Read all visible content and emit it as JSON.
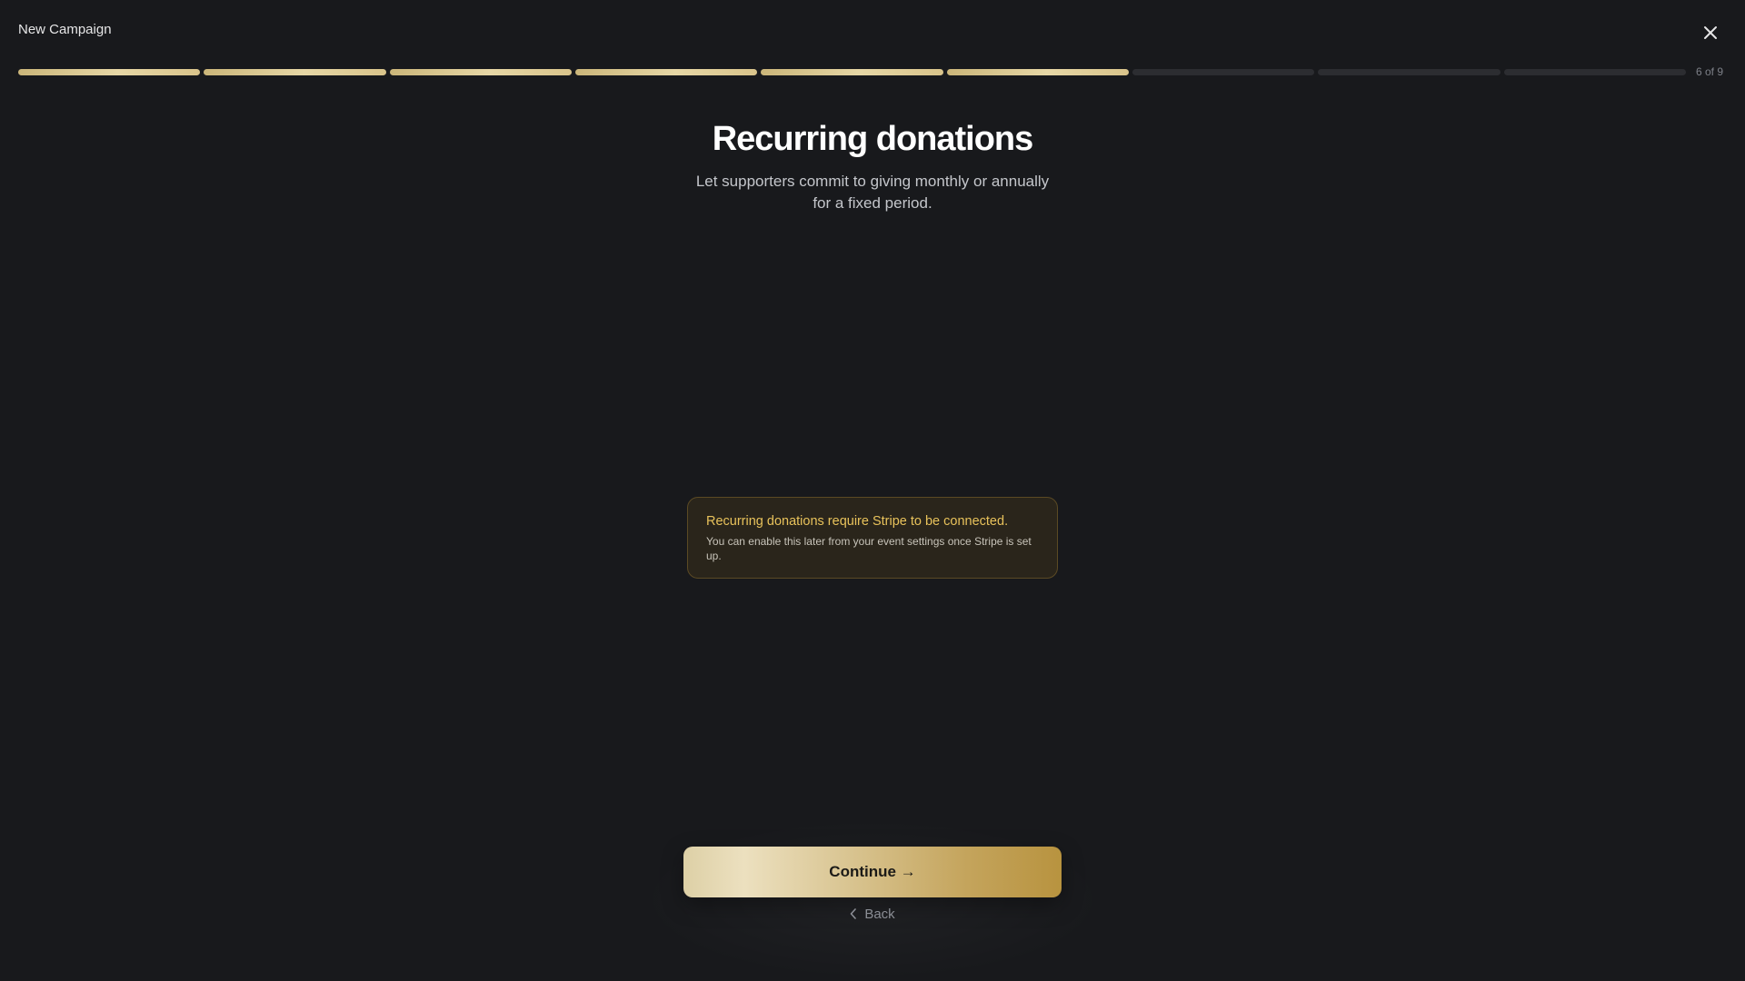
{
  "header": {
    "title": "New Campaign",
    "close_icon": "close-icon"
  },
  "progress": {
    "total_steps": 9,
    "completed_steps": 6,
    "label": "6 of 9"
  },
  "main": {
    "title": "Recurring donations",
    "subtitle": "Let supporters commit to giving monthly or annually for a fixed period."
  },
  "notice": {
    "title": "Recurring donations require Stripe to be connected.",
    "body": "You can enable this later from your event settings once Stripe is set up."
  },
  "footer": {
    "continue_label": "Continue →",
    "back_label": "Back",
    "back_icon": "chevron-left-icon"
  },
  "colors": {
    "background": "#18191c",
    "accent_gold": "#d9c48b",
    "notice_text": "#e8c25b"
  }
}
